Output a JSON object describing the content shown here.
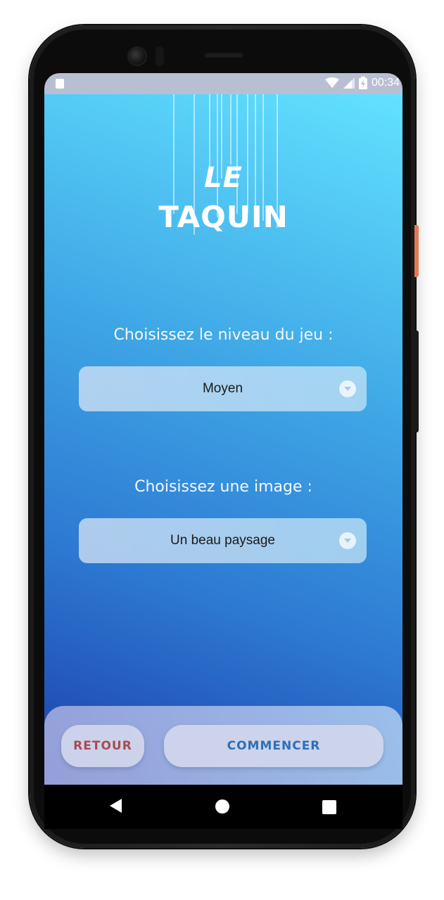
{
  "status_bar": {
    "time": "00:34",
    "icons": [
      "sim-card-icon",
      "wifi-icon",
      "signal-icon",
      "battery-charging-icon"
    ]
  },
  "app": {
    "logo": {
      "line1": "LE",
      "line2": "TAQUIN"
    },
    "level_section": {
      "label": "Choisissez le niveau du jeu :",
      "selected": "Moyen"
    },
    "image_section": {
      "label": "Choisissez une image :",
      "selected": "Un beau paysage"
    },
    "buttons": {
      "back_label": "RETOUR",
      "start_label": "COMMENCER"
    }
  },
  "navigation_bar": {
    "icons": [
      "back-triangle-icon",
      "home-circle-icon",
      "recent-apps-square-icon"
    ]
  },
  "colors": {
    "gradient_top": "#62e2ff",
    "gradient_bottom": "#1d3fa8",
    "retour_text": "#a84a55",
    "commencer_text": "#2d6fb8"
  }
}
